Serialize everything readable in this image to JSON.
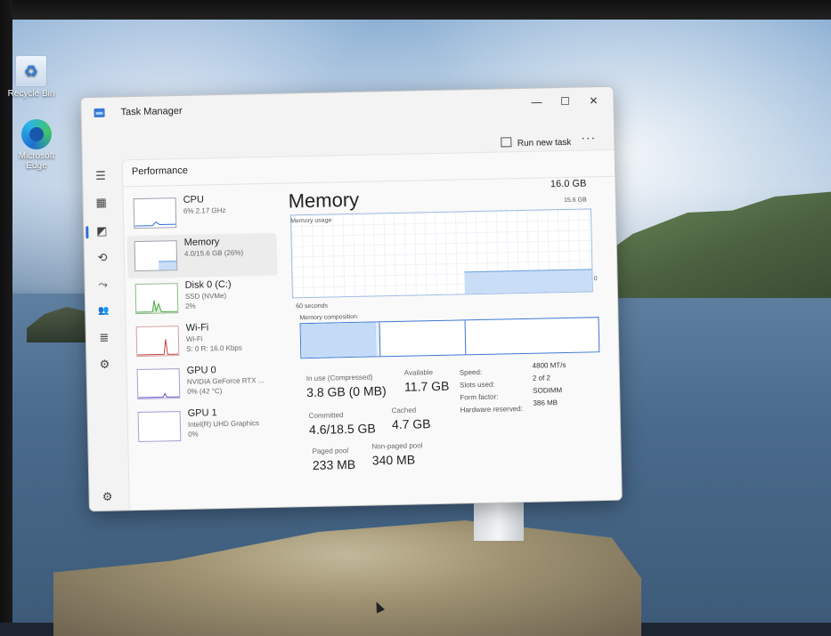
{
  "desktop": {
    "icons": [
      {
        "label": "Recycle Bin"
      },
      {
        "label": "Microsoft Edge"
      }
    ]
  },
  "window": {
    "title": "Task Manager",
    "minimize": "—",
    "maximize": "☐",
    "close": "✕"
  },
  "toolbar": {
    "run_new_task": "Run new task",
    "more": "···"
  },
  "page": {
    "title": "Performance"
  },
  "nav": {
    "hamburger": "☰",
    "processes": "▦",
    "performance": "◩",
    "app_history": "⟲",
    "startup": "⤳",
    "users": "👥",
    "details": "≣",
    "services": "⚙",
    "settings": "⚙"
  },
  "resources": [
    {
      "name": "CPU",
      "sub": "6%  2.17 GHz",
      "sub2": ""
    },
    {
      "name": "Memory",
      "sub": "4.0/15.6 GB (26%)",
      "sub2": ""
    },
    {
      "name": "Disk 0 (C:)",
      "sub": "SSD (NVMe)",
      "sub2": "2%"
    },
    {
      "name": "Wi-Fi",
      "sub": "Wi-Fi",
      "sub2": "S: 0  R: 16.0 Kbps"
    },
    {
      "name": "GPU 0",
      "sub": "NVIDIA GeForce RTX ...",
      "sub2": "0%  (42 °C)"
    },
    {
      "name": "GPU 1",
      "sub": "Intel(R) UHD Graphics",
      "sub2": "0%"
    }
  ],
  "memory": {
    "title": "Memory",
    "total": "16.0 GB",
    "usage_label": "Memory usage",
    "usage_max": "15.6 GB",
    "zero": "0",
    "seconds": "60 seconds",
    "composition_label": "Memory composition",
    "usage_fraction": 0.26,
    "stats": {
      "in_use_label": "In use (Compressed)",
      "in_use": "3.8 GB (0 MB)",
      "available_label": "Available",
      "available": "11.7 GB",
      "committed_label": "Committed",
      "committed": "4.6/18.5 GB",
      "cached_label": "Cached",
      "cached": "4.7 GB",
      "paged_label": "Paged pool",
      "paged": "233 MB",
      "nonpaged_label": "Non-paged pool",
      "nonpaged": "340 MB"
    },
    "details": {
      "speed_label": "Speed:",
      "speed": "4800 MT/s",
      "slots_label": "Slots used:",
      "slots": "2 of 2",
      "form_label": "Form factor:",
      "form": "SODIMM",
      "reserved_label": "Hardware reserved:",
      "reserved": "386 MB"
    }
  }
}
